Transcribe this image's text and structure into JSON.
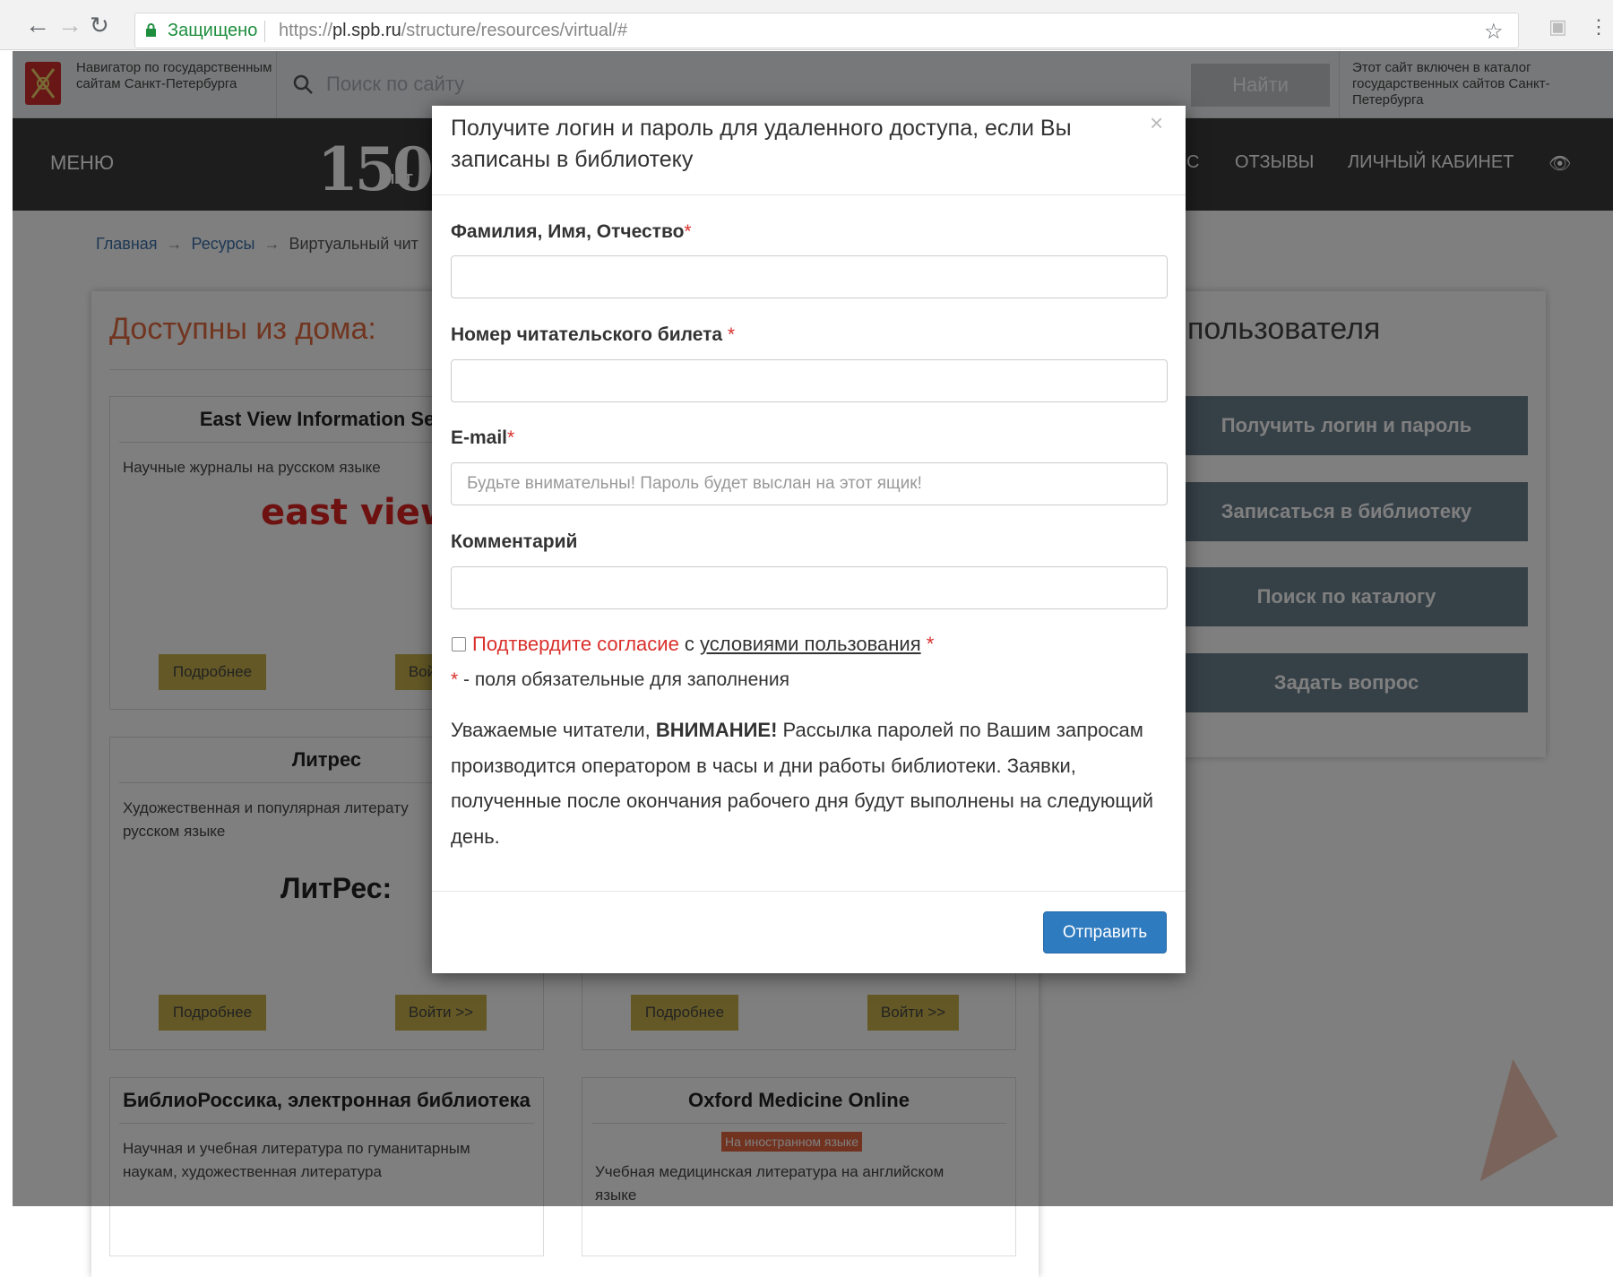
{
  "browser": {
    "secure_label": "Защищено",
    "url_prefix": "https://",
    "url_host": "pl.spb.ru",
    "url_path": "/structure/resources/virtual/#"
  },
  "govbar": {
    "navigator_title": "Навигатор по государственным сайтам Санкт-Петербурга",
    "search_placeholder": "Поиск по сайту",
    "find_button": "Найти",
    "catalog_note": "Этот сайт включен в каталог государственных сайтов Санкт-Петербурга"
  },
  "topbar": {
    "menu_label": "МЕНЮ",
    "logo_number": "150",
    "logo_sub": "ЛЕТ",
    "nav_partial": "С",
    "nav_reviews": "ОТЗЫВЫ",
    "nav_account": "ЛИЧНЫЙ КАБИНЕТ"
  },
  "breadcrumb": {
    "home": "Главная",
    "resources": "Ресурсы",
    "current": "Виртуальный чит"
  },
  "left": {
    "title": "Доступны из дома:",
    "cards": [
      {
        "title": "East View Information Serv",
        "desc": "Научные журналы на русском языке",
        "more": "Подробнее",
        "enter": "Вой",
        "logo": "east view"
      },
      {
        "title": "Литрес",
        "desc": "Художественная и популярная литерату русском языке",
        "more": "Подробнее",
        "enter": "Войти >>",
        "logo": "ЛитРес:"
      },
      {
        "more": "Подробнее",
        "enter": "Войти >>"
      },
      {
        "title": "БиблиоРоссика, электронная библиотека",
        "desc": "Научная и учебная литература по гуманитарным наукам, художественная литература"
      },
      {
        "title": "Oxford Medicine Online",
        "badge": "На иностранном языке",
        "desc": "Учебная медицинская литература на английском языке"
      }
    ]
  },
  "right": {
    "title": "т пользователя",
    "buttons": [
      "Получить логин и пароль",
      "Записаться в библиотеку",
      "Поиск по каталогу",
      "Задать вопрос"
    ]
  },
  "modal": {
    "header": "Получите логин и пароль для удаленного доступа, если Вы записаны в библиотеку",
    "close": "×",
    "fio_label": "Фамилия, Имя, Отчество",
    "ticket_label": "Номер читательского билета ",
    "email_label": "E-mail",
    "email_placeholder": "Будьте внимательны! Пароль будет выслан на этот ящик!",
    "comment_label": "Комментарий",
    "req_mark": "*",
    "consent_red": "Подтвердите согласие",
    "consent_mid": " с ",
    "consent_link": "условиями пользования",
    "required_note": " - поля обязательные для заполнения",
    "notice_start": "Уважаемые читатели, ",
    "notice_bold": "ВНИМАНИЕ!",
    "notice_rest": " Рассылка паролей по Вашим запросам производится оператором в часы и дни работы библиотеки. Заявки, полученные после окончания рабочего дня будут выполнены на следующий день.",
    "submit": "Отправить"
  }
}
